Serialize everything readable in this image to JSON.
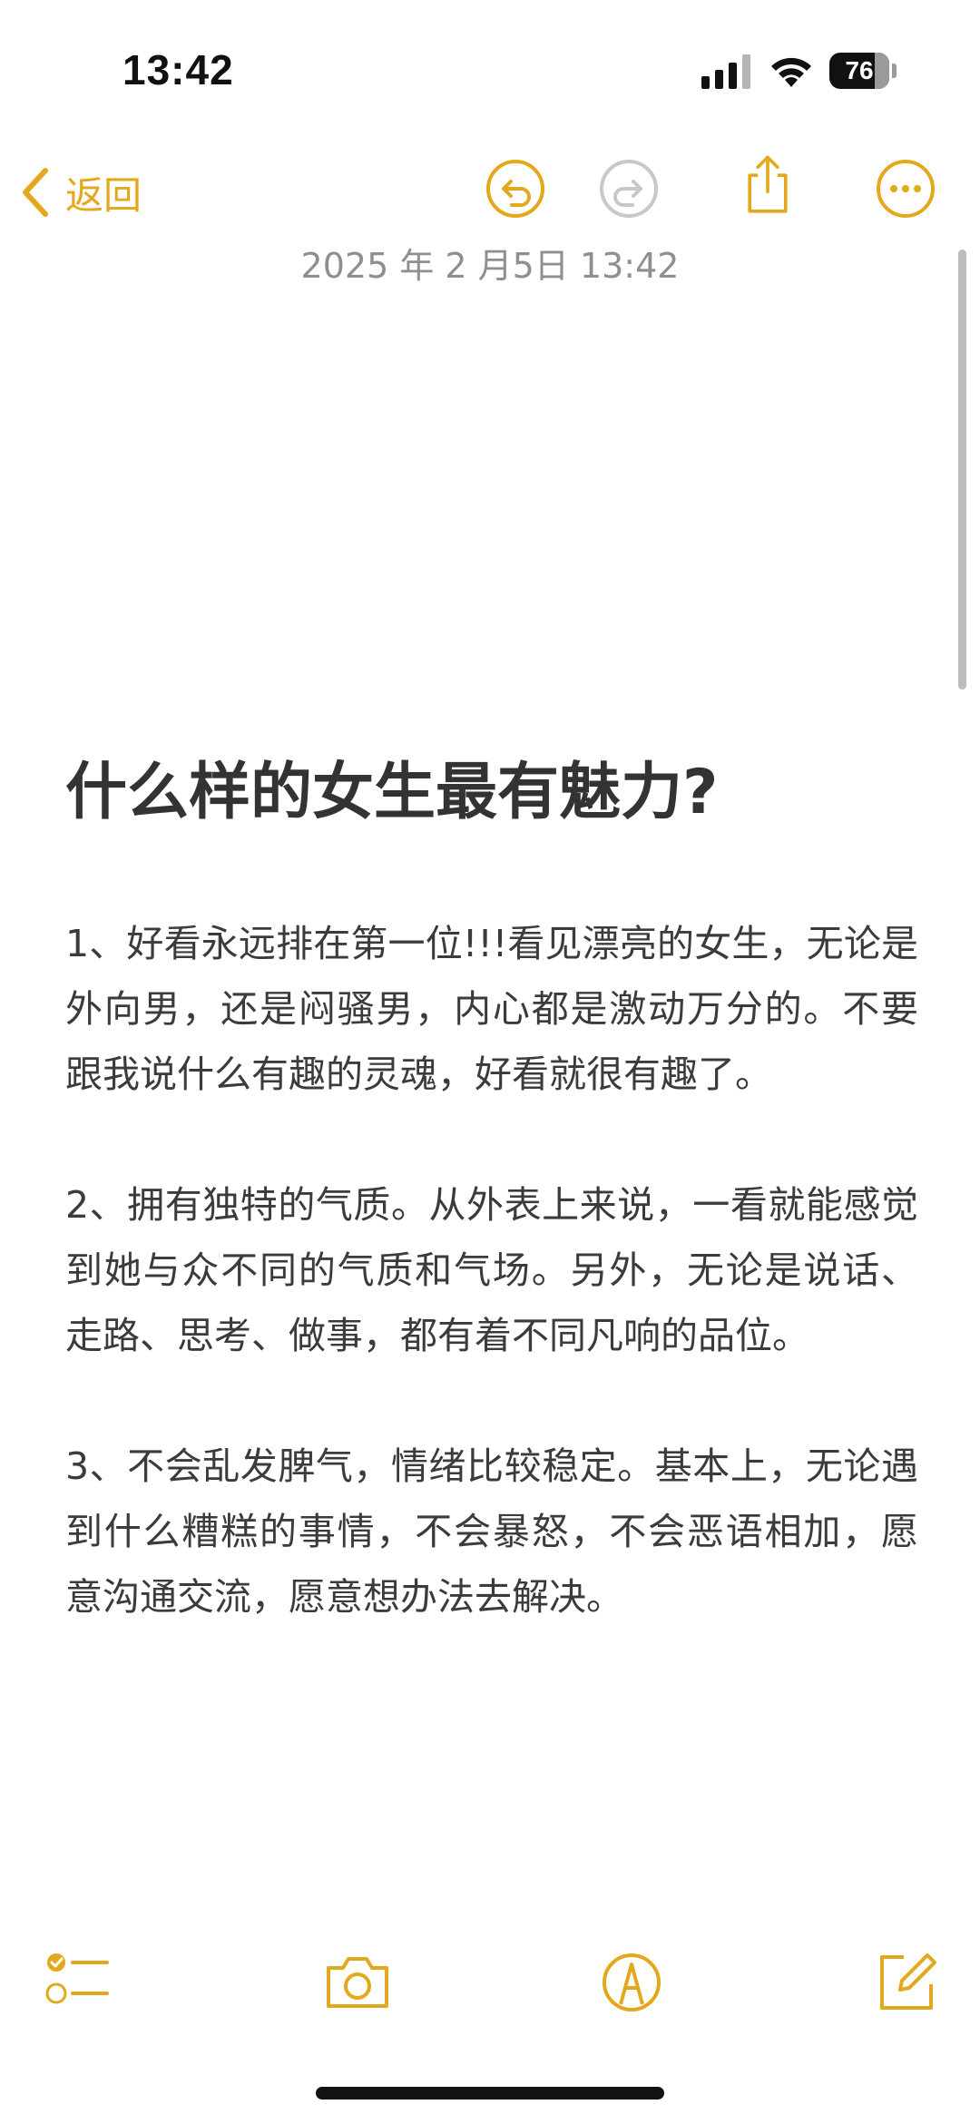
{
  "status_bar": {
    "time": "13:42",
    "battery": "76"
  },
  "toolbar": {
    "back_label": "返回",
    "icons": [
      "chevron-left-icon",
      "undo-icon",
      "redo-icon",
      "share-icon",
      "more-icon"
    ]
  },
  "note": {
    "date": "2025 年 2 月5日 13:42",
    "title": "什么样的女生最有魅力?",
    "paragraphs": [
      "1、好看永远排在第一位!!!看见漂亮的女生，无论是外向男，还是闷骚男，内心都是激动万分的。不要跟我说什么有趣的灵魂，好看就很有趣了。",
      "2、拥有独特的气质。从外表上来说，一看就能感觉到她与众不同的气质和气场。另外，无论是说话、走路、思考、做事，都有着不同凡响的品位。",
      "3、不会乱发脾气，情绪比较稳定。基本上，无论遇到什么糟糕的事情，不会暴怒，不会恶语相加，愿意沟通交流，愿意想办法去解决。"
    ]
  },
  "bottom_bar": {
    "icons": [
      "checklist-icon",
      "camera-icon",
      "markup-pen-icon",
      "compose-icon"
    ]
  },
  "colors": {
    "accent": "#e3a81c",
    "text": "#3b3b3b",
    "muted": "#8e8e93"
  }
}
